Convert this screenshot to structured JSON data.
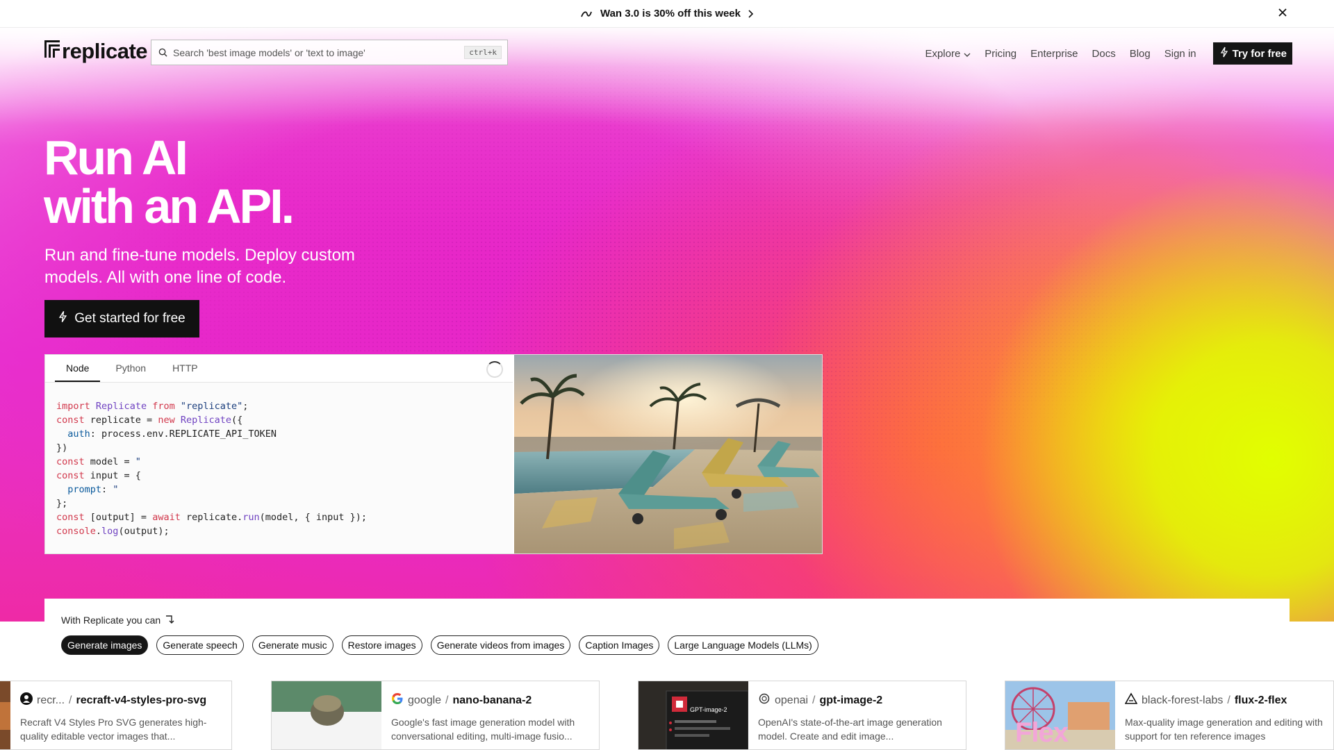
{
  "announcement": {
    "text": "Wan 3.0 is 30% off this week"
  },
  "header": {
    "logo_text": "replicate",
    "search_placeholder": "Search 'best image models' or 'text to image'",
    "search_shortcut": "ctrl+k",
    "nav": {
      "explore": "Explore",
      "pricing": "Pricing",
      "enterprise": "Enterprise",
      "docs": "Docs",
      "blog": "Blog",
      "sign_in": "Sign in",
      "try_free": "Try for free"
    }
  },
  "hero": {
    "title_line1": "Run AI",
    "title_line2": "with an API.",
    "subtitle": "Run and fine-tune models. Deploy custom models. All with one line of code.",
    "cta": "Get started for free"
  },
  "code_card": {
    "tabs": [
      "Node",
      "Python",
      "HTTP"
    ],
    "active_tab": "Node",
    "code_lines": [
      "import Replicate from \"replicate\";",
      "const replicate = new Replicate({",
      "  auth: process.env.REPLICATE_API_TOKEN",
      "})",
      "const model = \"",
      "const input = {",
      "  prompt: \"",
      "};",
      "const [output] = await replicate.run(model, { input });",
      "console.log(output);"
    ]
  },
  "capabilities": {
    "label": "With Replicate you can",
    "chips": [
      "Generate images",
      "Generate speech",
      "Generate music",
      "Restore images",
      "Generate videos from images",
      "Caption Images",
      "Large Language Models (LLMs)"
    ],
    "active_chip": "Generate images"
  },
  "models": [
    {
      "owner": "recr...",
      "name": "recraft-v4-styles-pro-svg",
      "description": "Recraft V4 Styles Pro SVG generates high-quality editable vector images that..."
    },
    {
      "owner": "google",
      "name": "nano-banana-2",
      "description": "Google's fast image generation model with conversational editing, multi-image fusio..."
    },
    {
      "owner": "openai",
      "name": "gpt-image-2",
      "description": "OpenAI's state-of-the-art image generation model. Create and edit image...",
      "thumb_text": "GPT-image-2"
    },
    {
      "owner": "black-forest-labs",
      "name": "flux-2-flex",
      "description": "Max-quality image generation and editing with support for ten reference images",
      "thumb_text": "Flex"
    }
  ],
  "colors": {
    "accent_dark": "#151515",
    "hero_magenta": "#e834d2",
    "hero_yellow": "#e1ff00",
    "hero_orange": "#ffaa1e"
  }
}
